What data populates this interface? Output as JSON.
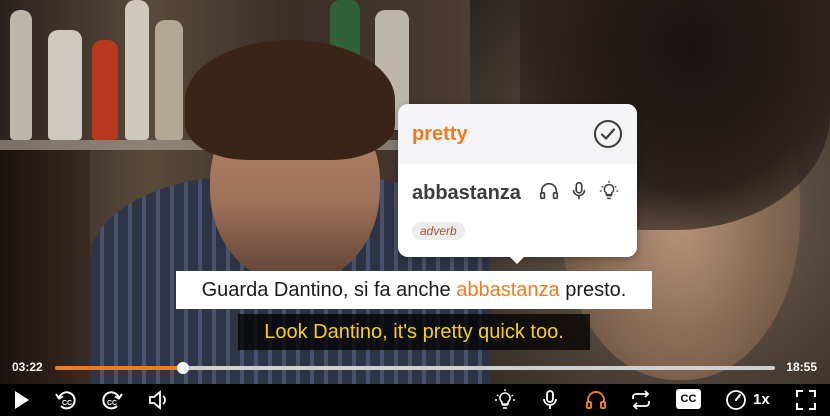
{
  "card": {
    "translation": "pretty",
    "word": "abbastanza",
    "part_of_speech": "adverb"
  },
  "subtitles": {
    "native_before": "Guarda Dantino, si fa anche ",
    "native_highlight": "abbastanza",
    "native_after": " presto.",
    "translation": "Look Dantino, it's pretty quick too."
  },
  "player": {
    "current_time": "03:22",
    "total_time": "18:55",
    "progress_fraction": 0.178,
    "cc_label": "CC",
    "speed_label": "1x"
  },
  "colors": {
    "accent": "#f07b1d",
    "subtitle_yellow": "#f5d020"
  },
  "icons": [
    "check-circle-icon",
    "headphones-icon",
    "microphone-icon",
    "lightbulb-icon",
    "play-icon",
    "rewind-cc-icon",
    "forward-cc-icon",
    "volume-icon",
    "loop-icon",
    "speed-gauge-icon",
    "fullscreen-icon"
  ]
}
